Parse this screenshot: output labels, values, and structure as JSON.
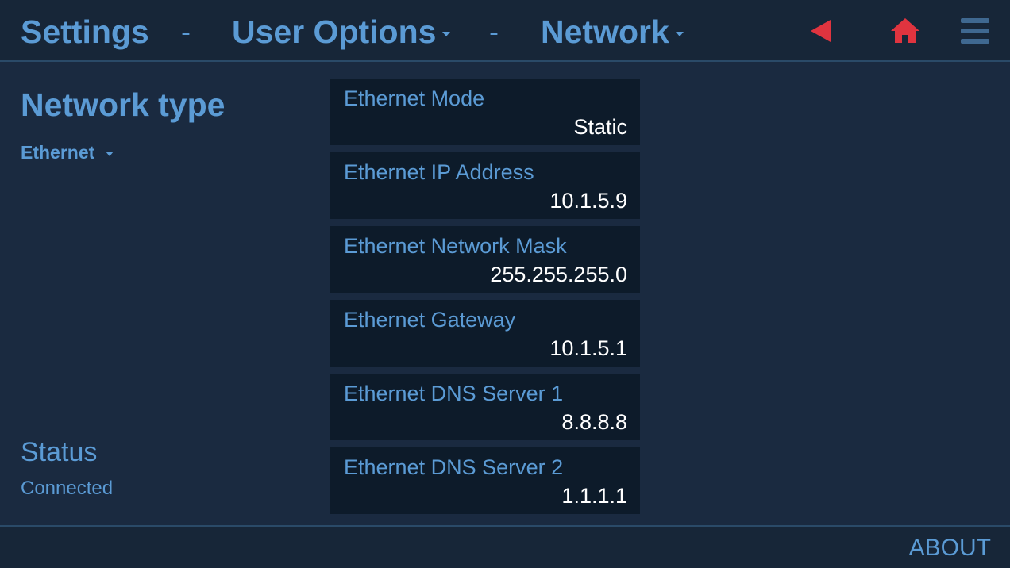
{
  "header": {
    "crumb1": "Settings",
    "sep1": "-",
    "crumb2": "User Options",
    "sep2": "-",
    "crumb3": "Network",
    "icons": [
      "back-arrow-icon",
      "home-icon",
      "menu-icon"
    ],
    "accent_color": "#e0343f"
  },
  "left": {
    "title": "Network type",
    "network_type_value": "Ethernet",
    "status_title": "Status",
    "status_value": "Connected"
  },
  "fields": [
    {
      "label": "Ethernet Mode",
      "value": "Static"
    },
    {
      "label": "Ethernet IP Address",
      "value": "10.1.5.9"
    },
    {
      "label": "Ethernet Network Mask",
      "value": "255.255.255.0"
    },
    {
      "label": "Ethernet Gateway",
      "value": "10.1.5.1"
    },
    {
      "label": "Ethernet DNS Server 1",
      "value": "8.8.8.8"
    },
    {
      "label": "Ethernet DNS Server 2",
      "value": "1.1.1.1"
    }
  ],
  "footer": {
    "about_label": "ABOUT"
  },
  "colors": {
    "background": "#1a2a40",
    "text_blue": "#5b9bd5",
    "field_bg": "#0d1b2a",
    "value_text": "#ffffff"
  }
}
